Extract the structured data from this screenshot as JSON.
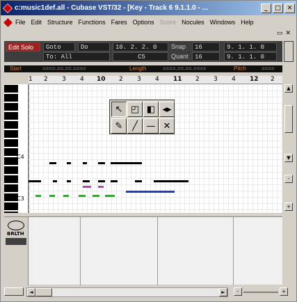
{
  "window": {
    "title": "c:music1def.all - Cubase VST/32 - [Key - Track 6 9.1.1.0 - ..."
  },
  "menu": {
    "items": [
      "File",
      "Edit",
      "Structure",
      "Functions",
      "Fares",
      "Options",
      "Score",
      "Nocules",
      "Windows",
      "Help"
    ],
    "disabled": [
      "Score"
    ]
  },
  "toolbar": {
    "edit_solo": "Edit Solo",
    "goto_label": "Goto",
    "do_label": "Do",
    "pos1": "10. 2. 2.   0",
    "to_label": "To: All",
    "note_value": "C5",
    "snap_label": "Snap",
    "snap_value": "16",
    "quant_label": "Quant",
    "quant_value": "16",
    "loc1": "9. 1. 1.   0",
    "loc2": "9. 1. 1.   0"
  },
  "infobar": {
    "start": "Start",
    "start_val": "====.==.==.====",
    "length": "Length",
    "length_val": "====.==.==.====",
    "pitch": "Pitch",
    "pitch_val": "===="
  },
  "ruler": {
    "marks": [
      "1",
      "2",
      "3",
      "4",
      "10",
      "2",
      "3",
      "4",
      "11",
      "2",
      "3",
      "4",
      "12",
      "2"
    ]
  },
  "keys": {
    "labels": [
      "C4",
      "C3"
    ]
  },
  "ctrlpane": {
    "label": "BRLTH"
  },
  "toolbox": {
    "tools": [
      "pointer-icon",
      "eraser-icon",
      "speaker-icon",
      "split-icon",
      "pencil-icon",
      "brush-icon",
      "line-icon",
      "mute-icon"
    ]
  }
}
